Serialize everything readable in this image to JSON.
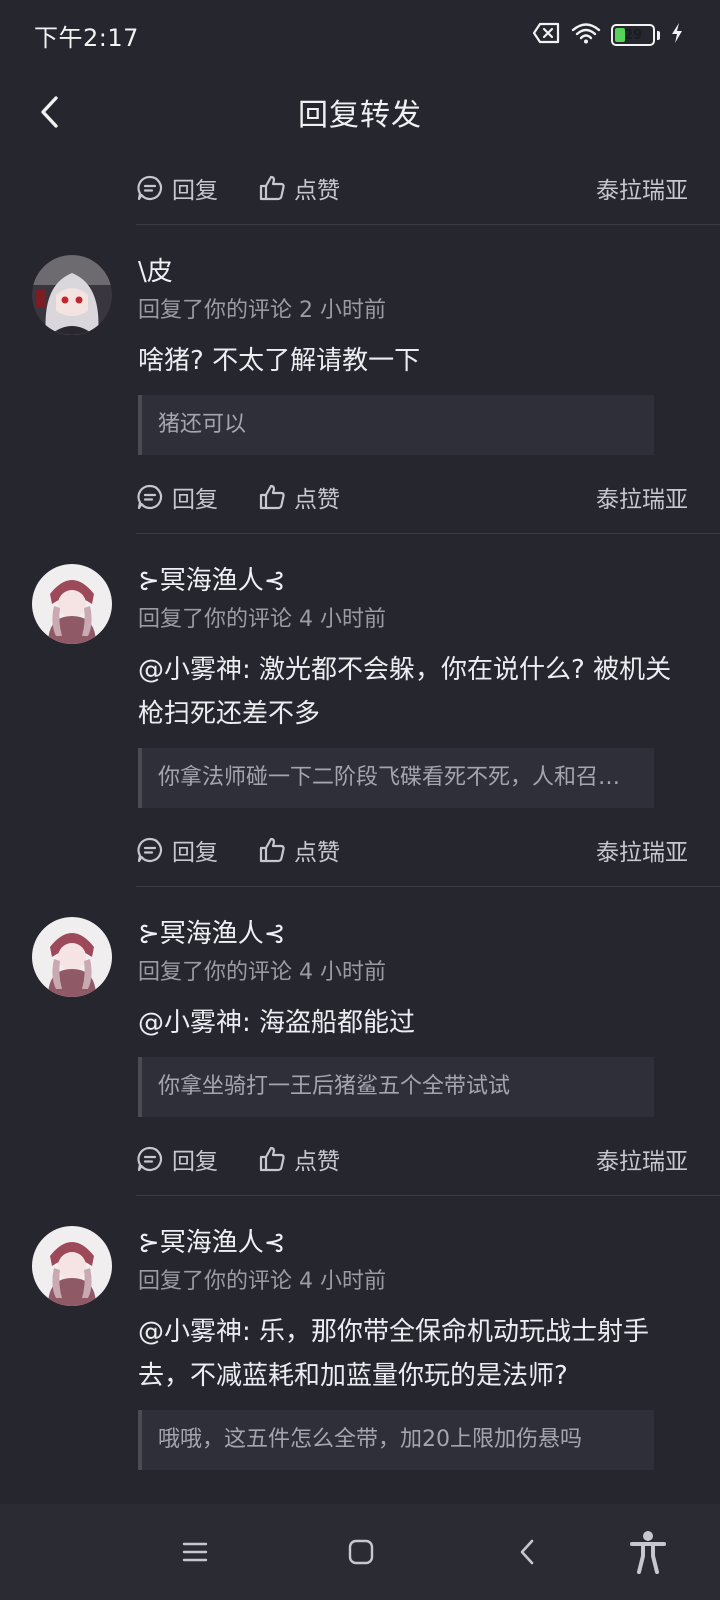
{
  "status_bar": {
    "time": "下午2:17",
    "battery": "29"
  },
  "header": {
    "title": "回复转发"
  },
  "actions": {
    "reply": "回复",
    "like": "点赞",
    "source": "泰拉瑞亚"
  },
  "replies": [
    {
      "username": "\\皮",
      "meta": "回复了你的评论 2 小时前",
      "content": "啥猪? 不太了解请教一下",
      "quote": "猪还可以"
    },
    {
      "username": "⊱冥海渔人⊰",
      "meta": "回复了你的评论 4 小时前",
      "content": "@小雾神: 激光都不会躲，你在说什么? 被机关枪扫死还差不多",
      "quote": "你拿法师碰一下二阶段飞碟看死不死，人和召…"
    },
    {
      "username": "⊱冥海渔人⊰",
      "meta": "回复了你的评论 4 小时前",
      "content": "@小雾神: 海盗船都能过",
      "quote": "你拿坐骑打一王后猪鲨五个全带试试"
    },
    {
      "username": "⊱冥海渔人⊰",
      "meta": "回复了你的评论 4 小时前",
      "content": "@小雾神: 乐，那你带全保命机动玩战士射手去，不减蓝耗和加蓝量你玩的是法师?",
      "quote": "哦哦，这五件怎么全带，加20上限加伤悬吗"
    }
  ]
}
